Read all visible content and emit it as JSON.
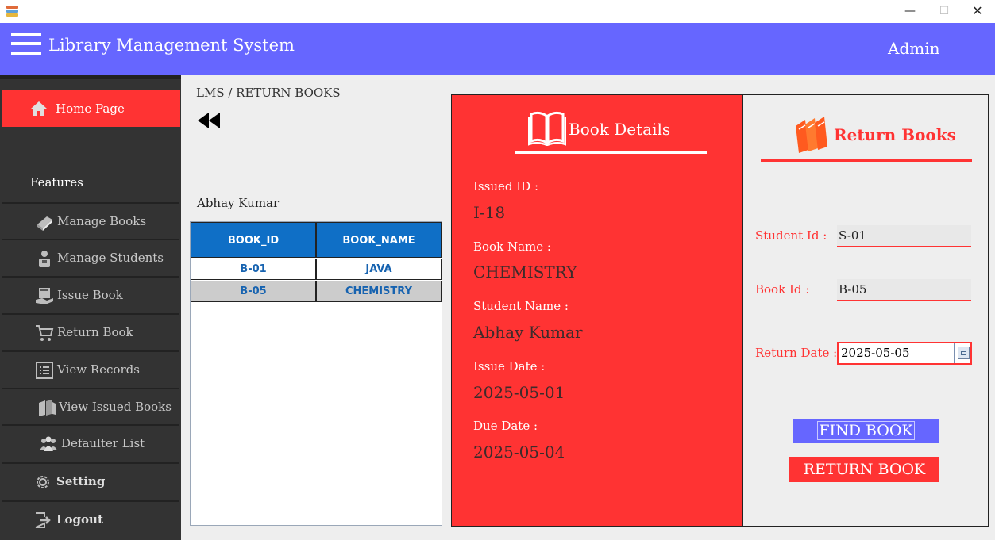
{
  "window": {
    "minimize_glyph": "—",
    "maximize_glyph": "☐",
    "close_glyph": "✕"
  },
  "header": {
    "title": "Library Management System",
    "user": "Admin"
  },
  "sidebar": {
    "home": "Home Page",
    "features_heading": "Features",
    "items": [
      {
        "label": "Manage Books",
        "icon": "book-icon"
      },
      {
        "label": "Manage Students",
        "icon": "student-icon"
      },
      {
        "label": "Issue Book",
        "icon": "issue-book-icon"
      },
      {
        "label": "Return Book",
        "icon": "cart-icon"
      },
      {
        "label": "View Records",
        "icon": "list-icon"
      },
      {
        "label": "View Issued Books",
        "icon": "books-icon"
      },
      {
        "label": "Defaulter List",
        "icon": "group-icon"
      },
      {
        "label": "Setting",
        "icon": "gear-icon"
      },
      {
        "label": "Logout",
        "icon": "logout-icon"
      }
    ]
  },
  "breadcrumb": "LMS / RETURN BOOKS",
  "student_name": "Abhay Kumar",
  "table": {
    "columns": [
      "BOOK_ID",
      "BOOK_NAME"
    ],
    "rows": [
      [
        "B-01",
        "JAVA"
      ],
      [
        "B-05",
        "CHEMISTRY"
      ]
    ]
  },
  "book_details": {
    "title": "Book Details",
    "issued_id_label": "Issued ID :",
    "issued_id": "I-18",
    "book_name_label": "Book Name :",
    "book_name": "CHEMISTRY",
    "student_name_label": "Student Name :",
    "student_name": "Abhay Kumar",
    "issue_date_label": "Issue Date :",
    "issue_date": "2025-05-01",
    "due_date_label": "Due Date :",
    "due_date": "2025-05-04"
  },
  "return_form": {
    "title": "Return Books",
    "student_id_label": "Student Id :",
    "student_id": "S-01",
    "book_id_label": "Book Id :",
    "book_id": "B-05",
    "return_date_label": "Return Date :",
    "return_date": "2025-05-05",
    "find_button": "FIND BOOK",
    "return_button": "RETURN BOOK"
  },
  "colors": {
    "header": "#6666ff",
    "accent_red": "#ff3333",
    "sidebar": "#333333",
    "table_header": "#0f6fc6"
  }
}
